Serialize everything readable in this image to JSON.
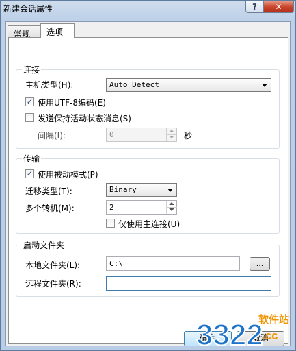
{
  "window": {
    "title": "新建会话属性"
  },
  "titlebar": {
    "help_glyph": "?",
    "close_glyph": "✕"
  },
  "tabs": [
    {
      "label": "常规",
      "active": false
    },
    {
      "label": "选项",
      "active": true
    }
  ],
  "connection": {
    "title": "连接",
    "host_type_label": "主机类型(H):",
    "host_type_value": "Auto Detect",
    "utf8_label": "使用UTF-8编码(E)",
    "utf8_checked": true,
    "keepalive_label": "发送保持活动状态消息(S)",
    "keepalive_checked": false,
    "interval_label": "间隔(I):",
    "interval_value": "0",
    "interval_unit": "秒"
  },
  "transfer": {
    "title": "传输",
    "passive_label": "使用被动模式(P)",
    "passive_checked": true,
    "transfer_type_label": "迁移类型(T):",
    "transfer_type_value": "Binary",
    "multi_label": "多个转机(M):",
    "multi_value": "2",
    "main_only_label": "仅使用主连接(U)",
    "main_only_checked": false
  },
  "startup_folder": {
    "title": "启动文件夹",
    "local_label": "本地文件夹(L):",
    "local_value": "C:\\",
    "browse_label": "...",
    "remote_label": "远程文件夹(R):",
    "remote_value": ""
  },
  "buttons": {
    "ok_label": "确定",
    "cancel_label": "取消"
  },
  "watermark": {
    "number_text": "3322",
    "site_text": "软件站",
    "domain_text": ".cc"
  },
  "colors": {
    "accent": "#3c7fb1",
    "check": "#2a3e78",
    "watermark_orange": "#f29400",
    "watermark_blue": "#1f74c9"
  }
}
